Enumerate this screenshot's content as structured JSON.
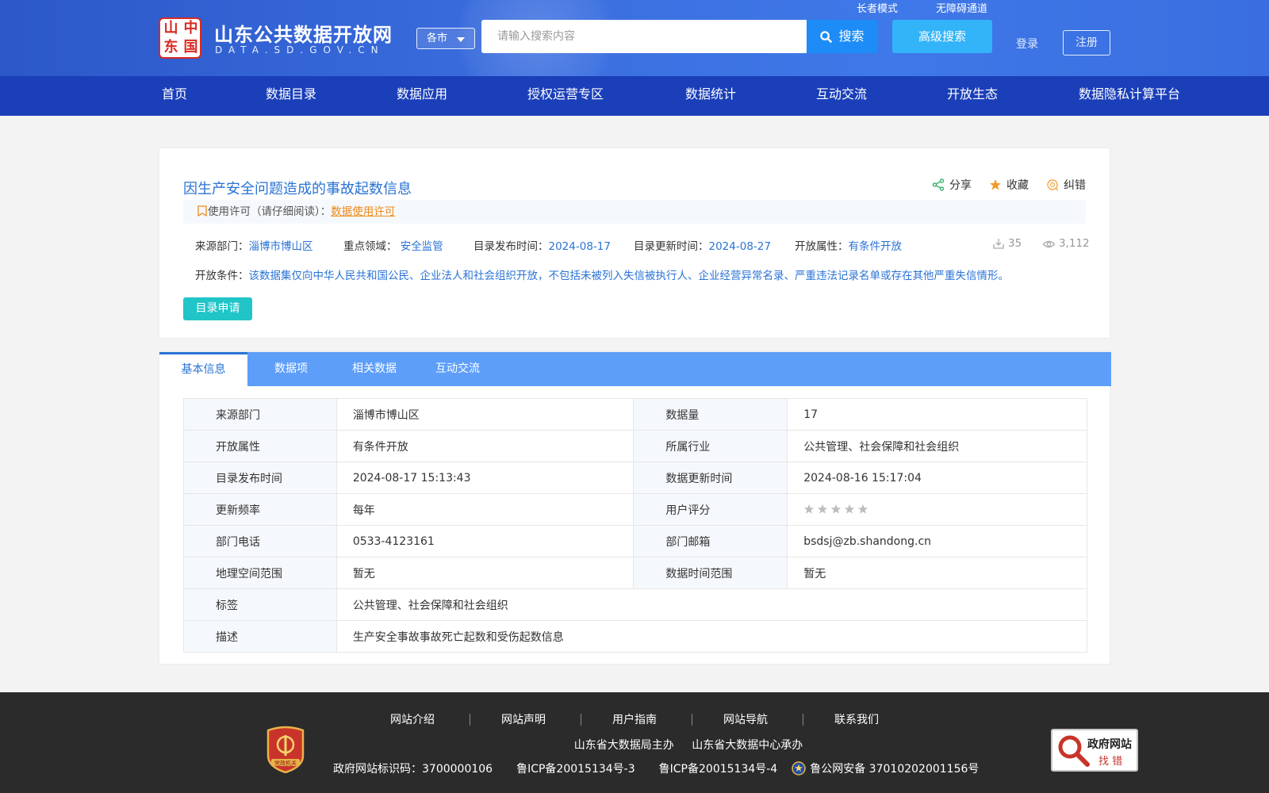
{
  "header": {
    "logo_glyphs": [
      "中",
      "国",
      "山",
      "东"
    ],
    "logo_title": "山东公共数据开放网",
    "logo_subtitle": "DATA.SD.GOV.CN",
    "city_select": "各市",
    "search_placeholder": "请输入搜索内容",
    "search_button": "搜索",
    "advanced_search": "高级搜索",
    "elder_mode": "长者模式",
    "accessibility": "无障碍通道",
    "login": "登录",
    "register": "注册"
  },
  "nav": [
    "首页",
    "数据目录",
    "数据应用",
    "授权运营专区",
    "数据统计",
    "互动交流",
    "开放生态",
    "数据隐私计算平台"
  ],
  "dataset": {
    "title": "因生产安全问题造成的事故起数信息",
    "actions": {
      "share": "分享",
      "favorite": "收藏",
      "report": "纠错"
    },
    "license_label": "使用许可（请仔细阅读）：",
    "license_link": "数据使用许可",
    "meta": {
      "source_label": "来源部门：",
      "source": "淄博市博山区",
      "domain_label": "重点领域：",
      "domain": "安全监管",
      "publish_label": "目录发布时间：",
      "publish": "2024-08-17",
      "update_label": "目录更新时间：",
      "update": "2024-08-27",
      "open_label": "开放属性：",
      "open": "有条件开放"
    },
    "downloads": "35",
    "views": "3,112",
    "condition_label": "开放条件：",
    "condition": "该数据集仅向中华人民共和国公民、企业法人和社会组织开放，不包括未被列入失信被执行人、企业经营异常名录、严重违法记录名单或存在其他严重失信情形。",
    "apply_button": "目录申请"
  },
  "tabs": [
    "基本信息",
    "数据项",
    "相关数据",
    "互动交流"
  ],
  "info_table": {
    "r1": {
      "l1": "来源部门",
      "v1": "淄博市博山区",
      "l2": "数据量",
      "v2": "17"
    },
    "r2": {
      "l1": "开放属性",
      "v1": "有条件开放",
      "l2": "所属行业",
      "v2": "公共管理、社会保障和社会组织"
    },
    "r3": {
      "l1": "目录发布时间",
      "v1": "2024-08-17 15:13:43",
      "l2": "数据更新时间",
      "v2": "2024-08-16 15:17:04"
    },
    "r4": {
      "l1": "更新频率",
      "v1": "每年",
      "l2": "用户评分",
      "rating": 0
    },
    "r5": {
      "l1": "部门电话",
      "v1": "0533-4123161",
      "l2": "部门邮箱",
      "v2": "bsdsj@zb.shandong.cn"
    },
    "r6": {
      "l1": "地理空间范围",
      "v1": "暂无",
      "l2": "数据时间范围",
      "v2": "暂无"
    },
    "r7": {
      "l1": "标签",
      "v1": "公共管理、社会保障和社会组织"
    },
    "r8": {
      "l1": "描述",
      "v1": "生产安全事故事故死亡起数和受伤起数信息"
    }
  },
  "footer": {
    "links": [
      "网站介绍",
      "网站声明",
      "用户指南",
      "网站导航",
      "联系我们"
    ],
    "sponsor": "山东省大数据局主办",
    "undertaker": "山东省大数据中心承办",
    "site_code": "政府网站标识码：3700000106",
    "icp1": "鲁ICP备20015134号-3",
    "icp2": "鲁ICP备20015134号-4",
    "police": "鲁公网安备 37010202001156号",
    "badge_left": "党政机关",
    "badge_right_top": "政府网站",
    "badge_right_bottom": "找 错"
  },
  "colors": {
    "nav_bg": "#1a3fb9",
    "tab_bg": "#5d9ef9",
    "link": "#2a73d6",
    "apply": "#21c5c8",
    "license": "#f08a18"
  }
}
